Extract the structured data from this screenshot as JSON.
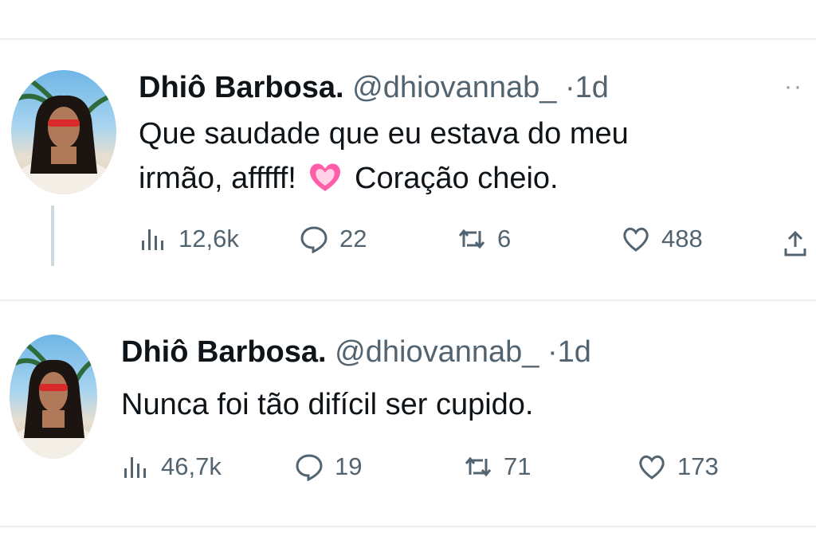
{
  "tweets": [
    {
      "name": "Dhiô Barbosa.",
      "handle": "@dhiovannab_",
      "dot": "·",
      "time": "1d",
      "more": "··",
      "text_line1": "Que saudade que eu estava do meu",
      "text_line2_start": "irmão, afffff!",
      "text_line2_end": "Coração cheio.",
      "emoji": "pink-heart-emoji",
      "views": "12,6k",
      "replies": "22",
      "retweets": "6",
      "likes": "488"
    },
    {
      "name": "Dhiô Barbosa.",
      "handle": "@dhiovannab_",
      "dot": "·",
      "time": "1d",
      "text": "Nunca foi tão difícil ser cupido.",
      "views": "46,7k",
      "replies": "19",
      "retweets": "71",
      "likes": "173"
    }
  ],
  "colors": {
    "text": "#0f1419",
    "secondary": "#536471",
    "divider": "#eceff1",
    "emoji": "#ff5fa8"
  }
}
